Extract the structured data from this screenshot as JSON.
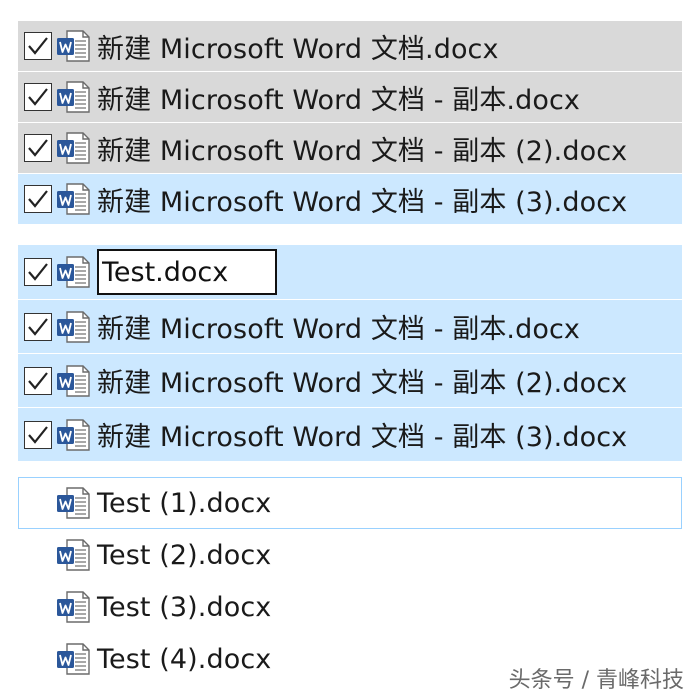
{
  "before_group": {
    "items": [
      {
        "name": "新建 Microsoft Word 文档.docx",
        "checked": true,
        "state": "selected-inactive"
      },
      {
        "name": "新建 Microsoft Word 文档 - 副本.docx",
        "checked": true,
        "state": "selected-inactive"
      },
      {
        "name": "新建 Microsoft Word 文档 - 副本 (2).docx",
        "checked": true,
        "state": "selected-inactive"
      },
      {
        "name": "新建 Microsoft Word 文档 - 副本 (3).docx",
        "checked": true,
        "state": "selected-focused"
      }
    ]
  },
  "rename_group": {
    "rename_value": "Test.docx",
    "items": [
      {
        "name": "新建 Microsoft Word 文档 - 副本.docx",
        "checked": true
      },
      {
        "name": "新建 Microsoft Word 文档 - 副本 (2).docx",
        "checked": true
      },
      {
        "name": "新建 Microsoft Word 文档 - 副本 (3).docx",
        "checked": true
      }
    ]
  },
  "result_group": {
    "items": [
      {
        "name": "Test (1).docx"
      },
      {
        "name": "Test (2).docx"
      },
      {
        "name": "Test (3).docx"
      },
      {
        "name": "Test (4).docx"
      }
    ]
  },
  "watermark": "头条号 / 青峰科技",
  "colors": {
    "selected_inactive": "#d9d9d9",
    "selected_active": "#cce8ff",
    "hover_outline": "#99d1ff",
    "word_blue": "#2b579a"
  },
  "icons": {
    "file": "word-document-icon",
    "check": "checkmark-icon"
  }
}
